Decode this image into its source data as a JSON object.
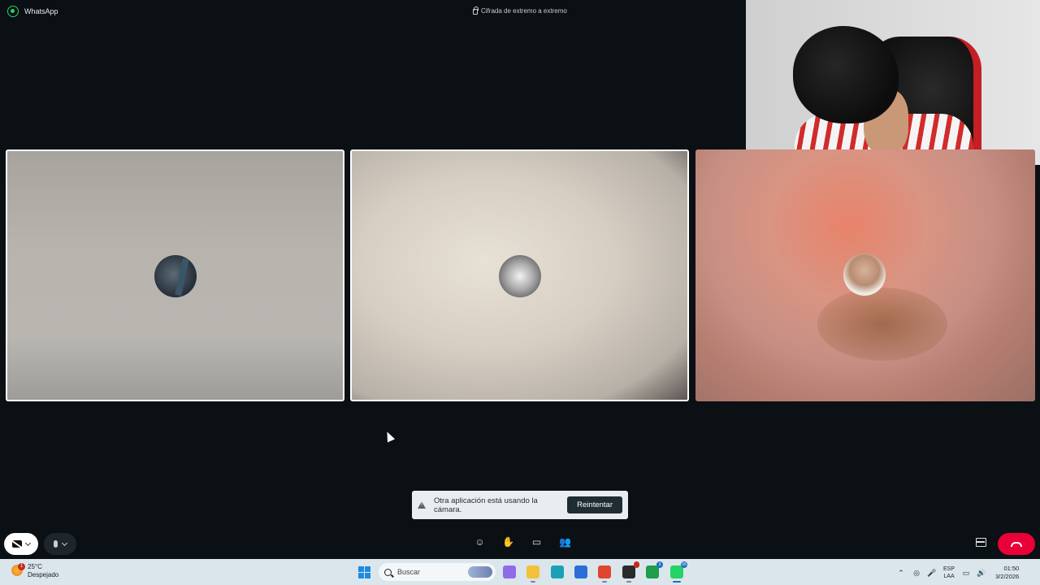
{
  "titlebar": {
    "app_name": "WhatsApp",
    "encryption": "Cifrada de extremo a extremo"
  },
  "participants": [
    {
      "selected": true
    },
    {
      "selected": true
    },
    {
      "selected": false
    }
  ],
  "toast": {
    "message": "Otra aplicación está usando la cámara.",
    "action": "Reintentar"
  },
  "controls": {
    "camera": "camera-off-icon",
    "mic": "mic-icon",
    "center": [
      "emoji-icon",
      "raise-hand-icon",
      "screen-share-icon",
      "participants-icon"
    ],
    "layout": "layout-icon",
    "end_call": "end-call-icon",
    "end_call_color": "#ea0038"
  },
  "taskbar": {
    "weather": {
      "temp": "25°C",
      "condition": "Despejado",
      "badge": "1"
    },
    "search_placeholder": "Buscar",
    "apps": [
      {
        "name": "copilot-icon",
        "color": "#8f6be8"
      },
      {
        "name": "file-explorer-icon",
        "color": "#f3c13a"
      },
      {
        "name": "edge-icon",
        "color": "#1aa1b5"
      },
      {
        "name": "store-icon",
        "color": "#2b6fd6"
      },
      {
        "name": "chrome-icon",
        "color": "#e0452f"
      },
      {
        "name": "dark-app-icon",
        "color": "#2a2a2a",
        "badge": ""
      },
      {
        "name": "xbox-icon",
        "color": "#1e9e4a",
        "badge": "3"
      },
      {
        "name": "whatsapp-icon",
        "color": "#25d366",
        "badge": "55"
      }
    ],
    "tray": {
      "lang": "ESP",
      "region": "LAA",
      "time": "01:50",
      "date": "3/2/2026"
    }
  }
}
